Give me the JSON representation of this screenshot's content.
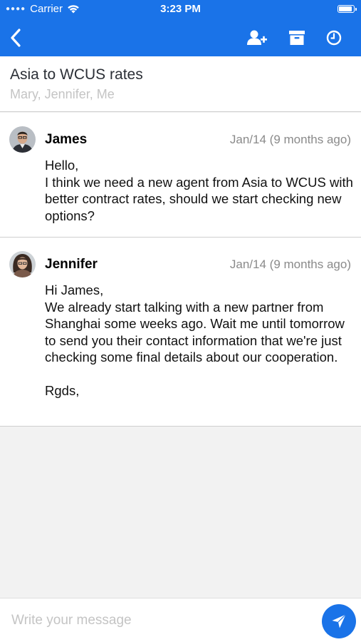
{
  "status_bar": {
    "carrier": "Carrier",
    "time": "3:23 PM",
    "signal_icon": "signal-dots-icon",
    "wifi_icon": "wifi-icon",
    "battery_icon": "battery-icon"
  },
  "nav": {
    "back_icon": "chevron-left-icon",
    "add_participant_icon": "add-person-icon",
    "archive_icon": "archive-icon",
    "snooze_icon": "clock-icon",
    "background": "#1a73e8"
  },
  "thread": {
    "subject": "Asia to WCUS rates",
    "participants": "Mary, Jennifer, Me"
  },
  "messages": [
    {
      "author": "James",
      "date": "Jan/14 (9 months ago)",
      "body": "Hello,\nI think we need a new agent from Asia to WCUS with better contract rates, should we start checking new options?"
    },
    {
      "author": "Jennifer",
      "date": "Jan/14 (9 months ago)",
      "body": "Hi James,\nWe already start talking with a new partner from Shanghai some weeks ago. Wait me until tomorrow to send you their contact information that we're just checking some final details about our cooperation.\n\nRgds,"
    }
  ],
  "composer": {
    "placeholder": "Write your message",
    "send_icon": "send-icon"
  }
}
